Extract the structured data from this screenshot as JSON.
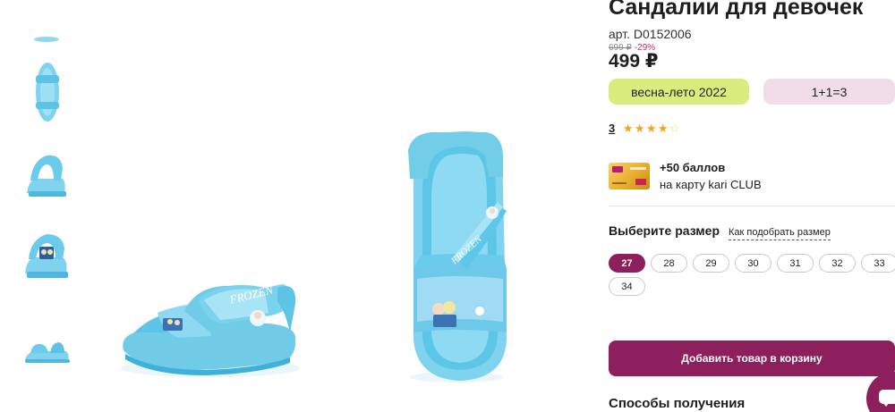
{
  "product": {
    "title": "Сандалии для девочек",
    "sku": "арт. D0152006",
    "old_price": "699 ₽",
    "discount": "-29%",
    "price": "499 ₽"
  },
  "tags": {
    "season": "весна-лето 2022",
    "promo": "1+1=3"
  },
  "rating": {
    "count": "3",
    "stars": 4,
    "max_stars": 5
  },
  "bonus": {
    "points": "+50 баллов",
    "card_text": "на карту kari CLUB"
  },
  "sizes": {
    "title": "Выберите размер",
    "guide_link": "Как подобрать размер",
    "options": [
      "27",
      "28",
      "29",
      "30",
      "31",
      "32",
      "33",
      "34"
    ],
    "selected": "27"
  },
  "actions": {
    "add_to_cart": "Добавить товар в корзину"
  },
  "delivery": {
    "title": "Способы получения"
  },
  "colors": {
    "accent": "#8c1f5c",
    "season_tag": "#d9ec7d",
    "promo_tag": "#f1dde8",
    "star": "#f4a51f",
    "product_blue": "#7fd3ee"
  }
}
